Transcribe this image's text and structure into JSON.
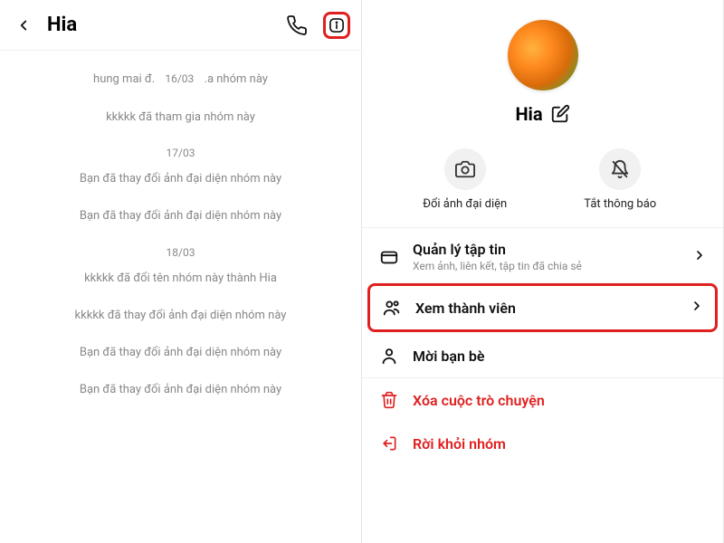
{
  "left": {
    "title": "Hia",
    "messages": [
      {
        "type": "split",
        "pre": "hung mai đ.",
        "date": "16/03",
        "post": ".a nhóm này"
      },
      {
        "type": "text",
        "text": "kkkkk đã tham gia nhóm này"
      },
      {
        "type": "date",
        "text": "17/03"
      },
      {
        "type": "text",
        "text": "Bạn đã thay đổi ảnh đại diện nhóm này"
      },
      {
        "type": "text",
        "text": "Bạn đã thay đổi ảnh đại diện nhóm này"
      },
      {
        "type": "date",
        "text": "18/03"
      },
      {
        "type": "text",
        "text": "kkkkk đã đổi tên nhóm này thành Hia"
      },
      {
        "type": "text",
        "text": "kkkkk đã thay đổi ảnh đại diện nhóm này"
      },
      {
        "type": "text",
        "text": "Bạn đã thay đổi ảnh đại diện nhóm này"
      },
      {
        "type": "text",
        "text": "Bạn đã thay đổi ảnh đại diện nhóm này"
      }
    ]
  },
  "right": {
    "profile_name": "Hia",
    "quick_actions": {
      "change_avatar": "Đổi ảnh đại diện",
      "mute": "Tắt thông báo"
    },
    "menu": {
      "files_title": "Quản lý tập tin",
      "files_sub": "Xem ảnh, liên kết, tập tin đã chia sẻ",
      "members": "Xem thành viên",
      "invite": "Mời bạn bè",
      "delete": "Xóa cuộc trò chuyện",
      "leave": "Rời khỏi nhóm"
    }
  }
}
